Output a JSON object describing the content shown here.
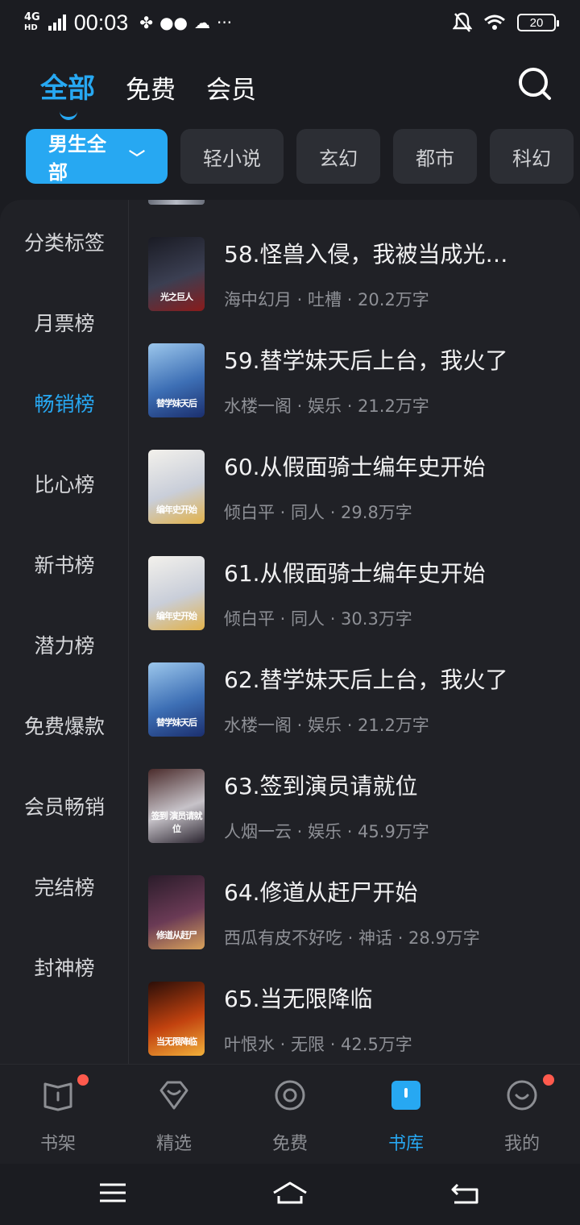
{
  "status": {
    "network": "4G",
    "network_sub": "HD",
    "time": "00:03",
    "apps_icons": [
      "pinwheel-icon",
      "wechat-icon",
      "cloud-icon",
      "more-icon"
    ],
    "battery": "20"
  },
  "top_tabs": [
    {
      "label": "全部",
      "active": true
    },
    {
      "label": "免费",
      "active": false
    },
    {
      "label": "会员",
      "active": false
    }
  ],
  "chips": [
    {
      "label": "男生全部",
      "active": true
    },
    {
      "label": "轻小说",
      "active": false
    },
    {
      "label": "玄幻",
      "active": false
    },
    {
      "label": "都市",
      "active": false
    },
    {
      "label": "科幻",
      "active": false
    }
  ],
  "sidebar": {
    "items": [
      {
        "label": "分类标签",
        "active": false
      },
      {
        "label": "月票榜",
        "active": false
      },
      {
        "label": "畅销榜",
        "active": true
      },
      {
        "label": "比心榜",
        "active": false
      },
      {
        "label": "新书榜",
        "active": false
      },
      {
        "label": "潜力榜",
        "active": false
      },
      {
        "label": "免费爆款",
        "active": false
      },
      {
        "label": "会员畅销",
        "active": false
      },
      {
        "label": "完结榜",
        "active": false
      },
      {
        "label": "封神榜",
        "active": false
      }
    ]
  },
  "books": [
    {
      "title": "58.怪兽入侵，我被当成光…",
      "meta": "海中幻月 · 吐槽 · 20.2万字",
      "cover_text": "光之巨人",
      "cover_colors": [
        "#1a1b24",
        "#3b3f52",
        "#8a1b1b"
      ]
    },
    {
      "title": "59.替学妹天后上台，我火了",
      "meta": "水楼一阁 · 娱乐 · 21.2万字",
      "cover_text": "替学妹天后",
      "cover_colors": [
        "#9cc7ec",
        "#3d6fb5",
        "#1b2f6e"
      ]
    },
    {
      "title": "60.从假面骑士编年史开始",
      "meta": "倾白平 · 同人 · 29.8万字",
      "cover_text": "编年史开始",
      "cover_colors": [
        "#f3f1ec",
        "#c9ced9",
        "#e2b24a"
      ]
    },
    {
      "title": "61.从假面骑士编年史开始",
      "meta": "倾白平 · 同人 · 30.3万字",
      "cover_text": "编年史开始",
      "cover_colors": [
        "#f3f1ec",
        "#c9ced9",
        "#e2b24a"
      ]
    },
    {
      "title": "62.替学妹天后上台，我火了",
      "meta": "水楼一阁 · 娱乐 · 21.2万字",
      "cover_text": "替学妹天后",
      "cover_colors": [
        "#9cc7ec",
        "#3d6fb5",
        "#1b2f6e"
      ]
    },
    {
      "title": "63.签到演员请就位",
      "meta": "人烟一云 · 娱乐 · 45.9万字",
      "cover_text": "签到 演员请就位",
      "cover_colors": [
        "#4a2b2b",
        "#c7c3c9",
        "#2b2530"
      ]
    },
    {
      "title": "64.修道从赶尸开始",
      "meta": "西瓜有皮不好吃 · 神话 · 28.9万字",
      "cover_text": "修道从赶尸",
      "cover_colors": [
        "#2a1c2a",
        "#6a3a55",
        "#d9a25b"
      ]
    },
    {
      "title": "65.当无限降临",
      "meta": "叶恨水 · 无限 · 42.5万字",
      "cover_text": "当无限降临",
      "cover_colors": [
        "#2b0e08",
        "#c2420f",
        "#f2b13a"
      ]
    }
  ],
  "bottom_nav": [
    {
      "label": "书架",
      "icon": "bookshelf-icon",
      "active": false,
      "badge": true
    },
    {
      "label": "精选",
      "icon": "heart-diamond-icon",
      "active": false,
      "badge": false
    },
    {
      "label": "免费",
      "icon": "free-circle-icon",
      "active": false,
      "badge": false
    },
    {
      "label": "书库",
      "icon": "library-icon",
      "active": true,
      "badge": false
    },
    {
      "label": "我的",
      "icon": "profile-face-icon",
      "active": false,
      "badge": true
    }
  ],
  "colors": {
    "accent": "#27a8f2",
    "badge": "#ff5a4d",
    "background": "#1b1c21"
  }
}
